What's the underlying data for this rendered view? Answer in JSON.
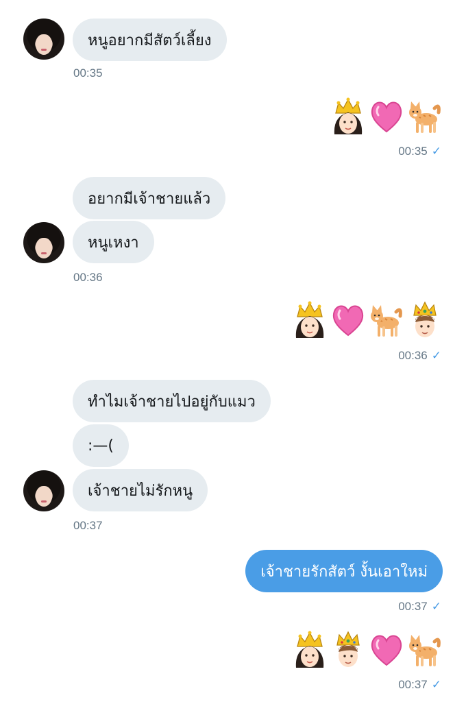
{
  "messages": {
    "m1": {
      "text": "หนูอยากมีสัตว์เลี้ยง",
      "time": "00:35"
    },
    "r1": {
      "emojis": [
        "princess-emoji",
        "heart-emoji",
        "cat-emoji"
      ],
      "time": "00:35"
    },
    "m2": {
      "texts": [
        "อยากมีเจ้าชายแล้ว",
        "หนูเหงา"
      ],
      "time": "00:36"
    },
    "r2": {
      "emojis": [
        "princess-emoji",
        "heart-emoji",
        "cat-emoji",
        "prince-emoji"
      ],
      "time": "00:36"
    },
    "m3": {
      "texts": [
        "ทำไมเจ้าชายไปอยู่กับแมว",
        ":—(",
        "เจ้าชายไม่รักหนู"
      ],
      "time": "00:37"
    },
    "r3": {
      "text": "เจ้าชายรักสัตว์ งั้นเอาใหม่",
      "time": "00:37"
    },
    "r4": {
      "emojis": [
        "princess-emoji",
        "prince-emoji",
        "heart-emoji",
        "cat-emoji"
      ],
      "time": "00:37"
    }
  },
  "read_mark": "✓",
  "colors": {
    "incoming_bubble": "#e6ecf0",
    "outgoing_bubble": "#4a9de6",
    "timestamp": "#657786"
  }
}
